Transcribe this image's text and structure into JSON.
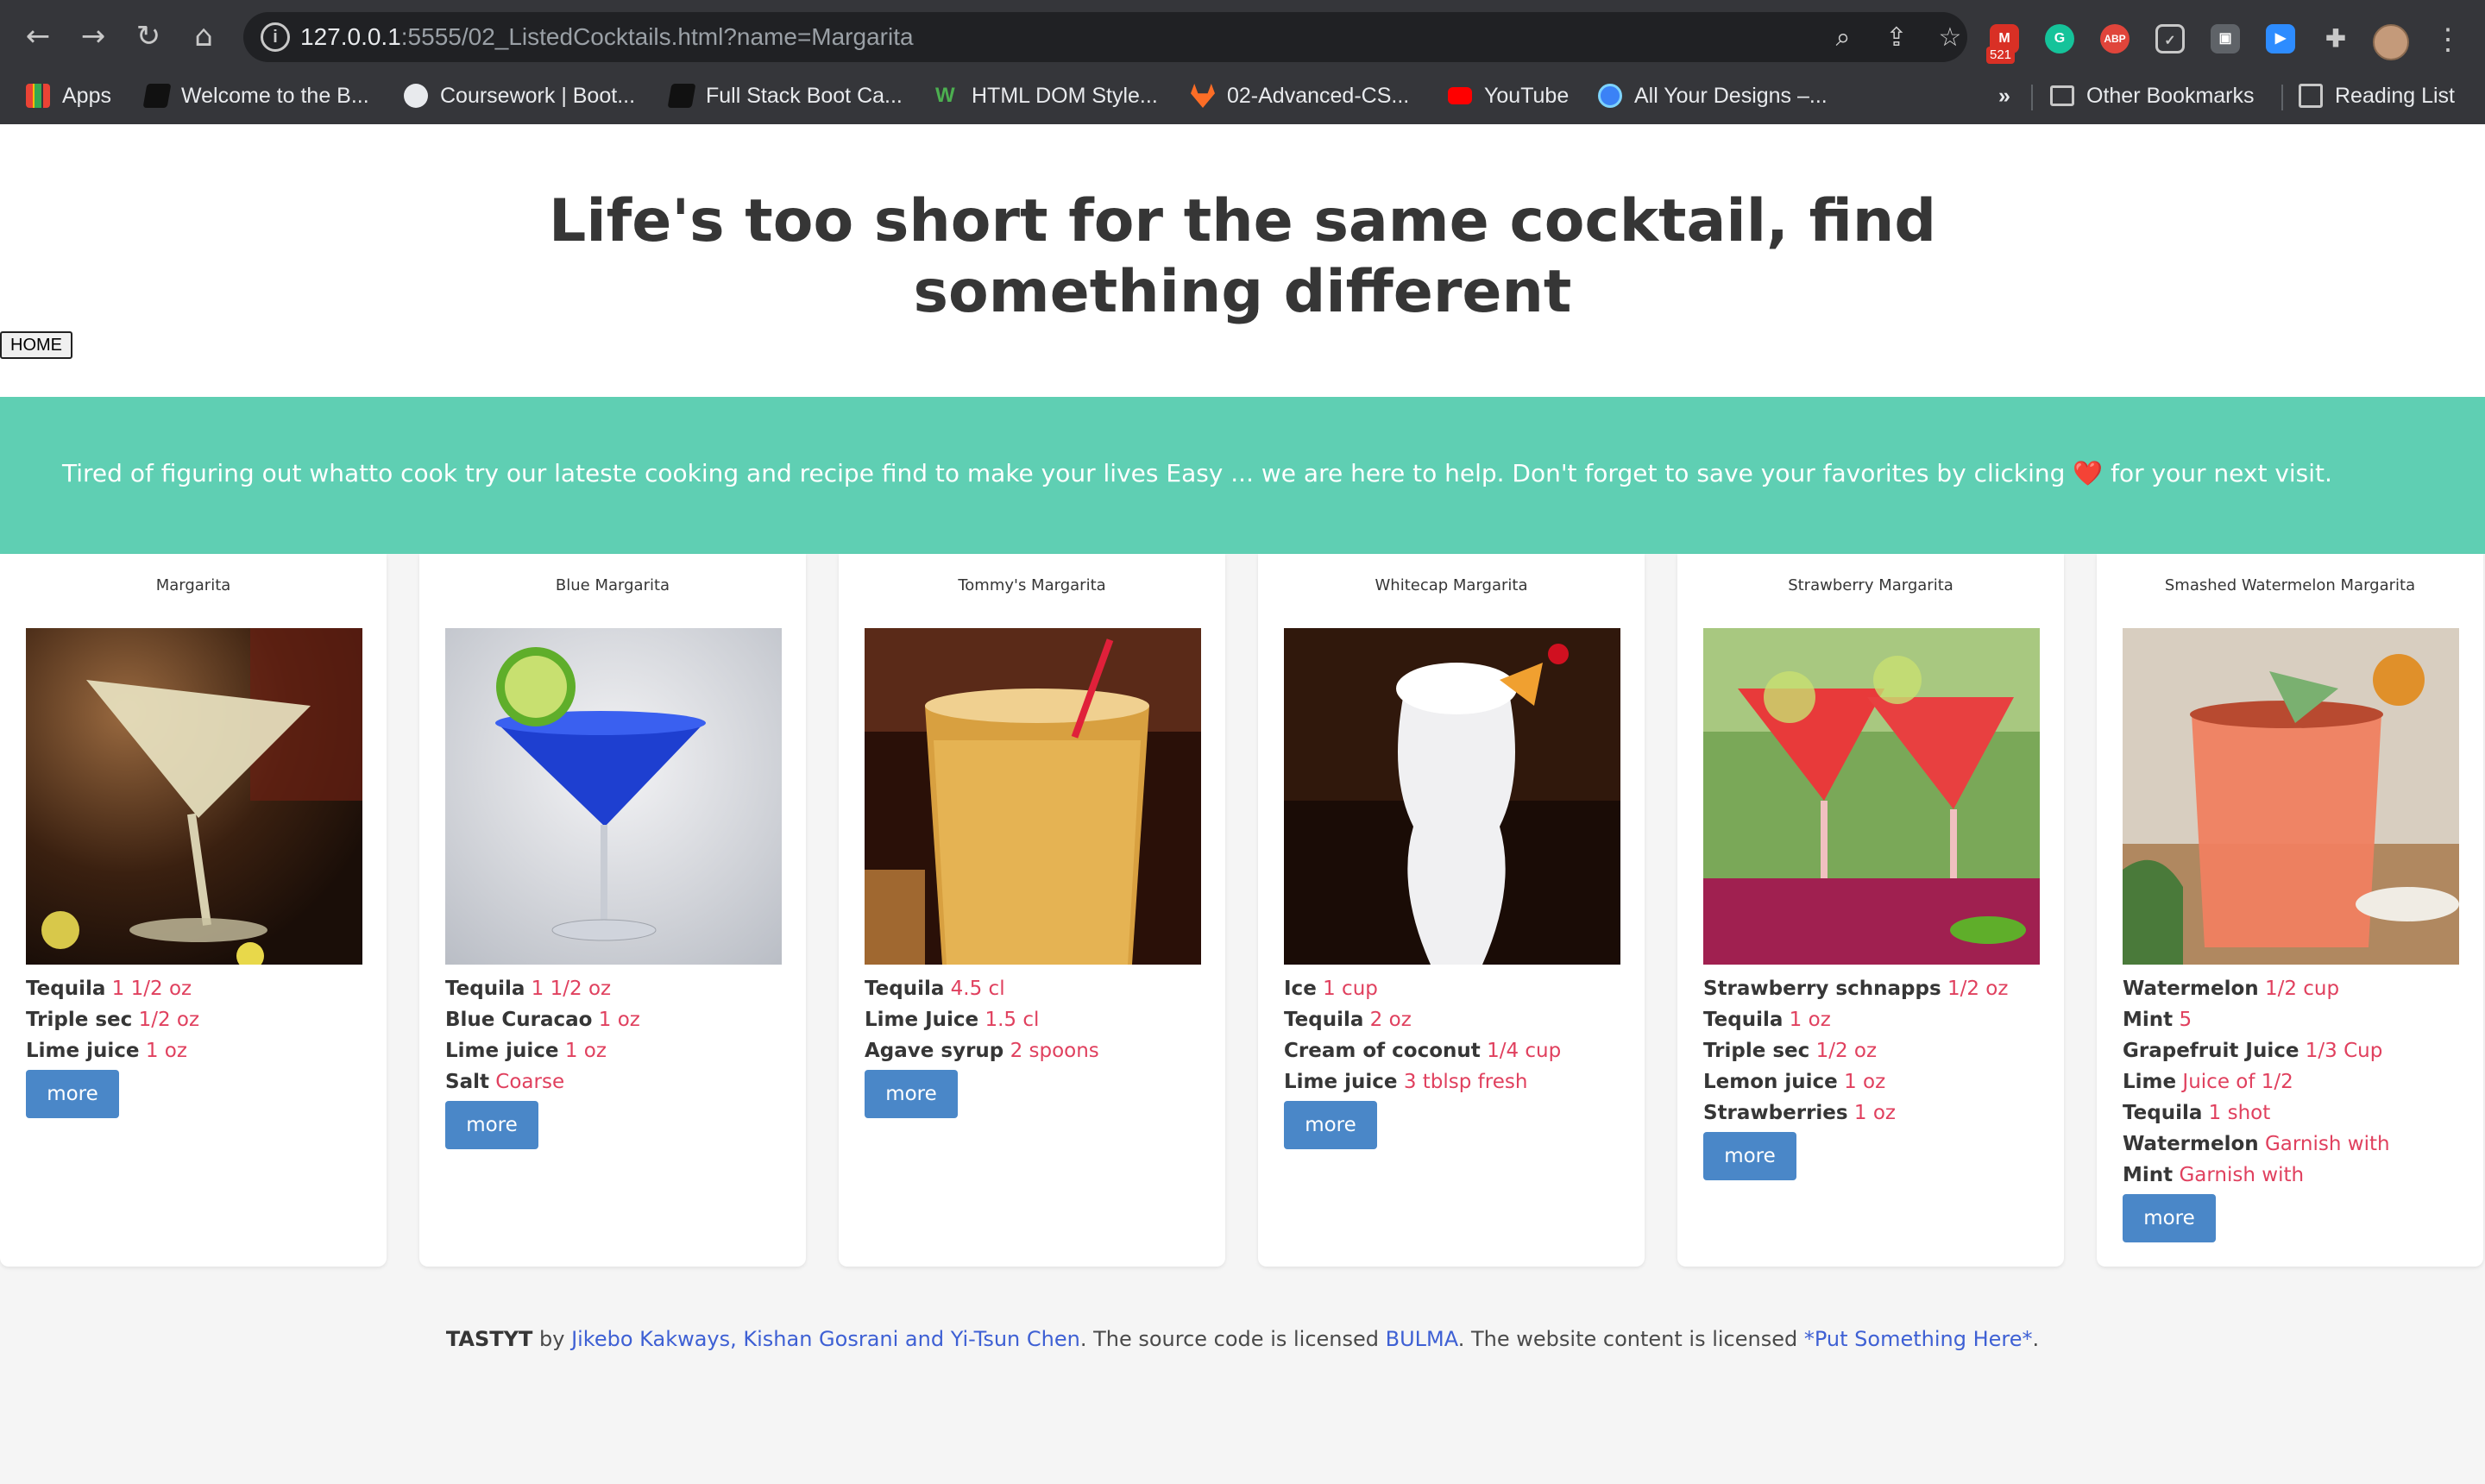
{
  "browser": {
    "url_host": "127.0.0.1",
    "url_rest": ":5555/02_ListedCocktails.html?name=Margarita",
    "mail_badge": "521",
    "bookmarks": [
      {
        "label": "Apps",
        "icon": "apps-grid-icon"
      },
      {
        "label": "Welcome to the B...",
        "icon": "book-icon"
      },
      {
        "label": "Coursework | Boot...",
        "icon": "globe-icon"
      },
      {
        "label": "Full Stack Boot Ca...",
        "icon": "book-icon"
      },
      {
        "label": "HTML DOM Style...",
        "icon": "w3schools-icon"
      },
      {
        "label": "02-Advanced-CS...",
        "icon": "gitlab-icon"
      },
      {
        "label": "YouTube",
        "icon": "youtube-icon"
      },
      {
        "label": "All Your Designs –...",
        "icon": "canva-icon"
      }
    ],
    "overflow_label": "»",
    "other_bookmarks": "Other Bookmarks",
    "reading_list": "Reading List"
  },
  "page": {
    "title": "Life's too short for the same cocktail, find something different",
    "home_label": "HOME",
    "banner_text": "Tired of figuring out whatto cook try our lateste cooking and recipe find to make your lives Easy ... we are here to help. Don't forget to save your favorites by clicking",
    "banner_heart": "❤️",
    "banner_tail": "for your next visit.",
    "more_label": "more"
  },
  "cards": [
    {
      "title": "Margarita",
      "image": "margarita-photo",
      "ingredients": [
        {
          "name": "Tequila",
          "measure": "1 1/2 oz"
        },
        {
          "name": "Triple sec",
          "measure": "1/2 oz"
        },
        {
          "name": "Lime juice",
          "measure": "1 oz"
        }
      ]
    },
    {
      "title": "Blue Margarita",
      "image": "blue-margarita-photo",
      "ingredients": [
        {
          "name": "Tequila",
          "measure": "1 1/2 oz"
        },
        {
          "name": "Blue Curacao",
          "measure": "1 oz"
        },
        {
          "name": "Lime juice",
          "measure": "1 oz"
        },
        {
          "name": "Salt",
          "measure": "Coarse"
        }
      ]
    },
    {
      "title": "Tommy's Margarita",
      "image": "tommys-margarita-photo",
      "ingredients": [
        {
          "name": "Tequila",
          "measure": "4.5 cl"
        },
        {
          "name": "Lime Juice",
          "measure": "1.5 cl"
        },
        {
          "name": "Agave syrup",
          "measure": "2 spoons"
        }
      ]
    },
    {
      "title": "Whitecap Margarita",
      "image": "whitecap-margarita-photo",
      "ingredients": [
        {
          "name": "Ice",
          "measure": "1 cup"
        },
        {
          "name": "Tequila",
          "measure": "2 oz"
        },
        {
          "name": "Cream of coconut",
          "measure": "1/4 cup"
        },
        {
          "name": "Lime juice",
          "measure": "3 tblsp fresh"
        }
      ]
    },
    {
      "title": "Strawberry Margarita",
      "image": "strawberry-margarita-photo",
      "ingredients": [
        {
          "name": "Strawberry schnapps",
          "measure": "1/2 oz"
        },
        {
          "name": "Tequila",
          "measure": "1 oz"
        },
        {
          "name": "Triple sec",
          "measure": "1/2 oz"
        },
        {
          "name": "Lemon juice",
          "measure": "1 oz"
        },
        {
          "name": "Strawberries",
          "measure": "1 oz"
        }
      ]
    },
    {
      "title": "Smashed Watermelon Margarita",
      "image": "watermelon-margarita-photo",
      "ingredients": [
        {
          "name": "Watermelon",
          "measure": "1/2 cup"
        },
        {
          "name": "Mint",
          "measure": "5"
        },
        {
          "name": "Grapefruit Juice",
          "measure": "1/3 Cup"
        },
        {
          "name": "Lime",
          "measure": "Juice of 1/2"
        },
        {
          "name": "Tequila",
          "measure": "1 shot"
        },
        {
          "name": "Watermelon",
          "measure": "Garnish with"
        },
        {
          "name": "Mint",
          "measure": "Garnish with"
        }
      ]
    }
  ],
  "footer": {
    "brand": "TASTYT",
    "by": " by ",
    "authors": "Jikebo Kakways, Kishan Gosrani and Yi-Tsun Chen",
    "mid": ". The source code is licensed ",
    "license": "BULMA",
    "mid2": ". The website content is licensed ",
    "content_license": "*Put Something Here*",
    "end": "."
  },
  "colors": {
    "banner": "#5fcfb3",
    "button": "#4a87c8",
    "measure": "#e0405e",
    "link": "#3e60d4",
    "chrome": "#35363a"
  }
}
